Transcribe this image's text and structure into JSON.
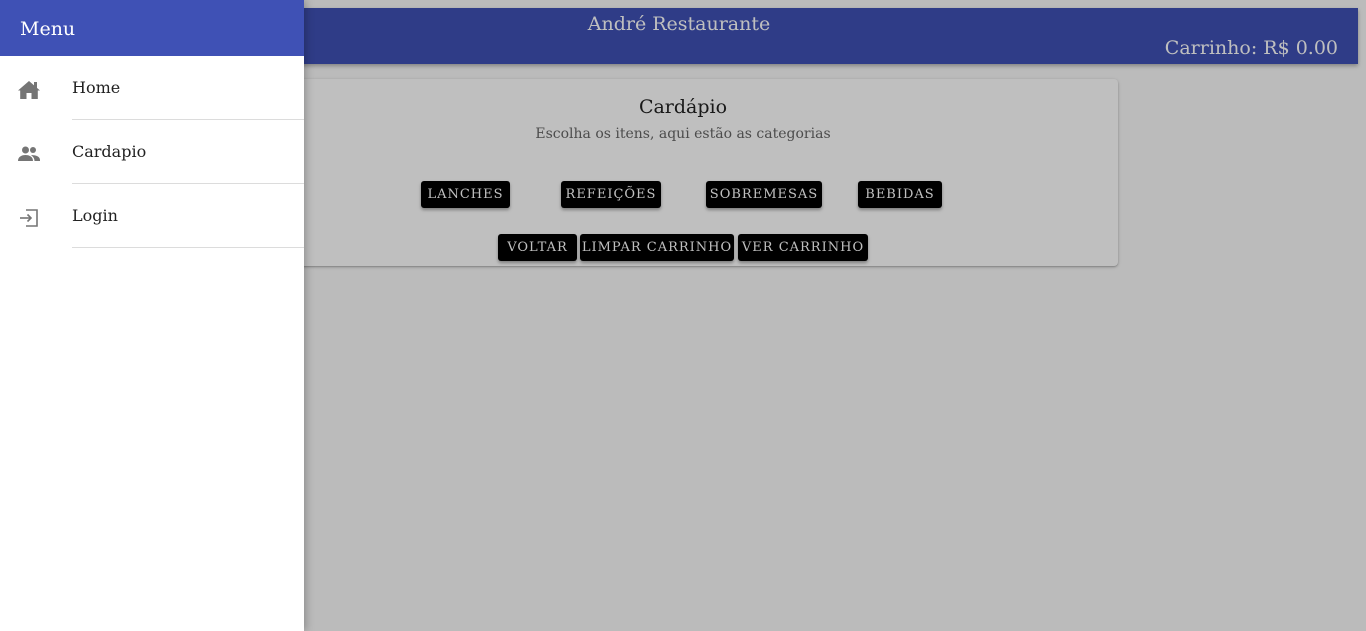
{
  "header": {
    "title": "André Restaurante",
    "cart_label": "Carrinho: R$ 0.00"
  },
  "card": {
    "title": "Cardápio",
    "subtitle": "Escolha os itens, aqui estão as categorias",
    "categories": [
      "Lanches",
      "Refeições",
      "Sobremesas",
      "Bebidas"
    ],
    "actions": [
      "Voltar",
      "Limpar carrinho",
      "Ver carrinho"
    ]
  },
  "drawer": {
    "title": "Menu",
    "items": [
      {
        "label": "Home",
        "icon": "home-icon"
      },
      {
        "label": "Cardapio",
        "icon": "people-icon"
      },
      {
        "label": "Login",
        "icon": "login-icon"
      }
    ]
  },
  "colors": {
    "primary": "#3f51b5",
    "button": "#000000"
  }
}
